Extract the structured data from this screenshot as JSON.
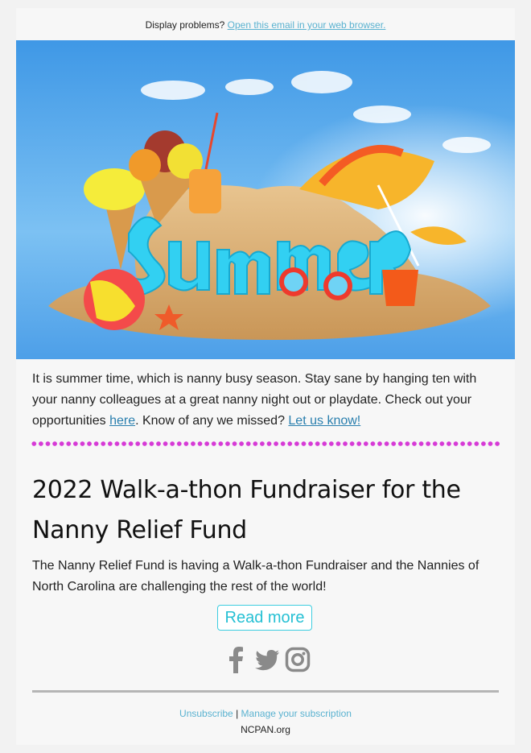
{
  "preheader": {
    "text": "Display problems?",
    "link_text": "Open this email in your web browser."
  },
  "hero": {
    "image_label": "Summer"
  },
  "intro": {
    "text_before": "It is summer time, which is nanny busy season. Stay sane by hanging ten with your nanny colleagues at a great nanny night out or playdate. Check out your opportunities ",
    "link1": "here",
    "text_middle": ". Know of any we missed? ",
    "link2": "Let us know!"
  },
  "article": {
    "title": "2022 Walk-a-thon Fundraiser for the Nanny Relief Fund",
    "body": "The Nanny Relief Fund is having a Walk-a-thon Fundraiser and the Nannies of North Carolina are challenging the rest of the world!",
    "button_label": "Read more"
  },
  "social": {
    "icons": [
      "facebook-icon",
      "twitter-icon",
      "instagram-icon"
    ],
    "icon_color": "#8a8a8a"
  },
  "footer": {
    "unsubscribe": "Unsubscribe",
    "separator": "|",
    "manage": "Manage your subscription",
    "site": "NCPAN.org"
  },
  "colors": {
    "link": "#5ab2d0",
    "button": "#26c0d4",
    "divider_dots": "#d63ad6",
    "background": "#f7f7f7"
  }
}
